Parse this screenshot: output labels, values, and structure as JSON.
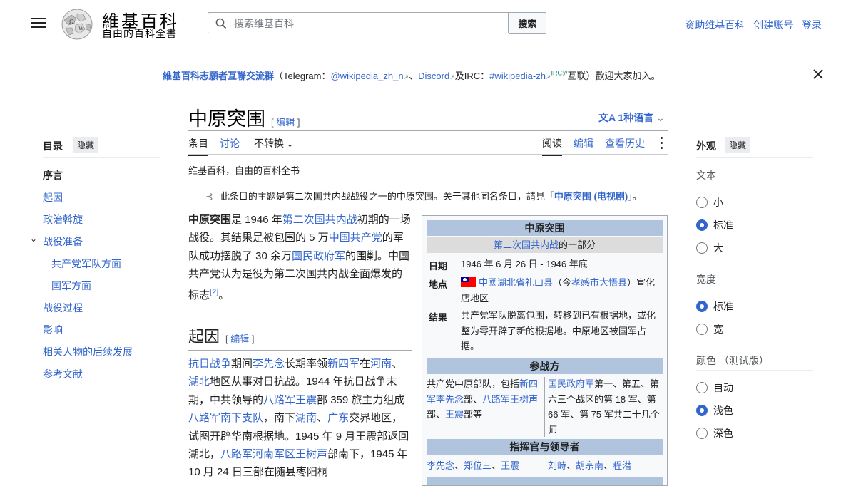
{
  "header": {
    "logo_title": "維基百科",
    "logo_tagline": "自由的百科全書",
    "search_placeholder": "搜索维基百科",
    "search_button": "搜索",
    "links": [
      "资助维基百科",
      "创建账号",
      "登录"
    ]
  },
  "banner": {
    "title": "維基百科志願者互聯交流群",
    "open": "（Telegram：",
    "telegram": "@wikipedia_zh_n",
    "sep1": "、",
    "discord": "Discord",
    "and": "及IRC：",
    "irc": "#wikipedia-zh",
    "irc_sup": "IRC://",
    "tail": "互联）歡迎大家加入。"
  },
  "article": {
    "title": "中原突围",
    "edit_label": "编辑",
    "languages": "1种语言",
    "tabs_left": [
      "条目",
      "讨论",
      "不转换"
    ],
    "tabs_right": [
      "阅读",
      "编辑",
      "查看历史"
    ],
    "tagline": "维基百科，自由的百科全书",
    "hatnote_text": "此条目的主题是第二次国共内战战役之一的中原突围。关于其他同名条目，請見「",
    "hatnote_link": "中原突围 (电视剧)",
    "hatnote_end": "」。",
    "p1": {
      "bold": "中原突围",
      "t1": "是 1946 年",
      "l1": "第二次国共内战",
      "t2": "初期的一场战役。其结果是被包围的 5 万",
      "l2": "中国共产党",
      "t3": "的军队成功摆脱了 30 余万",
      "l3": "国民政府军",
      "t4": "的围剿。中国共产党认为是役为第二次国共内战全面爆发的标志",
      "ref": "[2]",
      "t5": "。"
    },
    "section_title": "起因",
    "p2": {
      "l1": "抗日战争",
      "t1": "期间",
      "l2": "李先念",
      "t2": "长期率领",
      "l3": "新四军",
      "t3": "在",
      "l4": "河南",
      "t4": "、",
      "l5": "湖北",
      "t5": "地区从事对日抗战。1944 年抗日战争末期，中共领导的",
      "l6": "八路军",
      "l7": "王震",
      "t6": "部 359 旅主力组成",
      "l8": "八路军南下支队",
      "t7": "，南下",
      "l9": "湖南",
      "t8": "、",
      "l10": "广东",
      "t9": "交界地区，试图开辟华南根据地。1945 年 9 月王震部返回湖北，",
      "l11": "八路军河南军区",
      "l12": "王树声",
      "t10": "部南下，1945 年 10 月 24 日三部在随县枣阳桐"
    }
  },
  "infobox": {
    "title": "中原突围",
    "subtitle_link": "第二次国共内战",
    "subtitle_text": "的一部分",
    "date_label": "日期",
    "date_value": "1946 年 6 月 26 日 - 1946 年底",
    "place_label": "地点",
    "place_link1": "中國湖北省礼山县",
    "place_text1": "（今",
    "place_link2": "孝感市大悟县",
    "place_text2": "）宣化店地区",
    "result_label": "结果",
    "result_value": "共产党军队脱离包围，转移到已有根据地，或化整为零开辟了新的根据地。中原地区被国军占据。",
    "belligerents_title": "参战方",
    "left_col": {
      "t1": "共产党中原部队，包括",
      "l1": "新四军",
      "l2": "李先念",
      "t2": "部、",
      "l3": "八路军",
      "l4": "王树声",
      "t3": "部、",
      "l5": "王震",
      "t4": "部等"
    },
    "right_col": {
      "l1": "国民政府军",
      "t1": "第一、第五、第六三个战区的第 18 军、第 66 军、第 75 军共二十几个师"
    },
    "commanders_title": "指挥官与领导者",
    "commanders_left": [
      "李先念",
      "郑位三",
      "王震"
    ],
    "commanders_right": [
      "刘峙",
      "胡宗南",
      "程潜"
    ]
  },
  "toc": {
    "title": "目录",
    "hide": "隐藏",
    "items": [
      "序言",
      "起因",
      "政治斡旋",
      "战役准备",
      "共产党军队方面",
      "国军方面",
      "战役过程",
      "影响",
      "相关人物的后续发展",
      "参考文献"
    ]
  },
  "appearance": {
    "title": "外观",
    "hide": "隐藏",
    "text_label": "文本",
    "text_options": [
      "小",
      "标准",
      "大"
    ],
    "width_label": "宽度",
    "width_options": [
      "标准",
      "宽"
    ],
    "color_label": "颜色 （测试版）",
    "color_options": [
      "自动",
      "浅色",
      "深色"
    ]
  },
  "colors": {
    "link": "#3366cc",
    "infobox_header": "#b0c4de",
    "radio_selected": "#3366cc"
  },
  "icons": [
    "menu-icon",
    "wikipedia-globe-logo",
    "search-icon",
    "external-link-icon",
    "close-icon",
    "translate-icon",
    "chevron-down-icon",
    "more-icon",
    "disambiguation-icon",
    "flag-icon"
  ]
}
